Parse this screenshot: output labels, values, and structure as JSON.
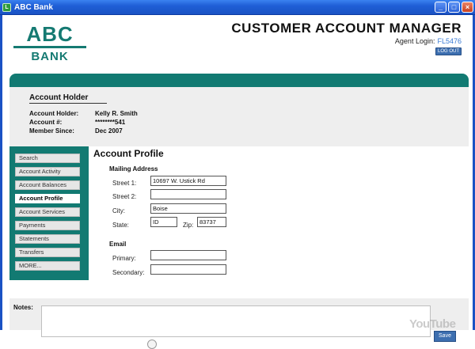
{
  "window": {
    "title": "ABC Bank",
    "icon_glyph": "L",
    "controls": {
      "minimize": "_",
      "maximize": "□",
      "close": "×"
    }
  },
  "logo": {
    "line1": "ABC",
    "line2": "BANK"
  },
  "header": {
    "app_title": "CUSTOMER ACCOUNT MANAGER",
    "agent_label": "Agent Login:",
    "agent_id": "FL5476",
    "logout_label": "LOG OUT"
  },
  "holder": {
    "heading": "Account Holder",
    "rows": [
      {
        "label": "Account Holder:",
        "value": "Kelly R. Smith"
      },
      {
        "label": "Account #:",
        "value": "********541"
      },
      {
        "label": "Member Since:",
        "value": "Dec 2007"
      }
    ]
  },
  "sidebar": {
    "items": [
      {
        "label": "Search",
        "active": false
      },
      {
        "label": "Account Activity",
        "active": false
      },
      {
        "label": "Account Balances",
        "active": false
      },
      {
        "label": "Account Profile",
        "active": true
      },
      {
        "label": "Account Services",
        "active": false
      },
      {
        "label": "Payments",
        "active": false
      },
      {
        "label": "Statements",
        "active": false
      },
      {
        "label": "Transfers",
        "active": false
      },
      {
        "label": "MORE...",
        "active": false
      }
    ]
  },
  "profile": {
    "title": "Account Profile",
    "mailing_heading": "Mailing Address",
    "street1_label": "Street 1:",
    "street1_value": "10697 W. Ustick Rd",
    "street2_label": "Street 2:",
    "street2_value": "",
    "city_label": "City:",
    "city_value": "Boise",
    "state_label": "State:",
    "state_value": "ID",
    "zip_label": "Zip:",
    "zip_value": "83737",
    "email_heading": "Email",
    "primary_label": "Primary:",
    "primary_value": "",
    "secondary_label": "Secondary:",
    "secondary_value": ""
  },
  "notes": {
    "label": "Notes:"
  },
  "watermark": "YouTube",
  "save_label": "Save",
  "colors": {
    "teal": "#127a72",
    "blue_button": "#3d6fb0",
    "titlebar": "#1f5fd6"
  }
}
